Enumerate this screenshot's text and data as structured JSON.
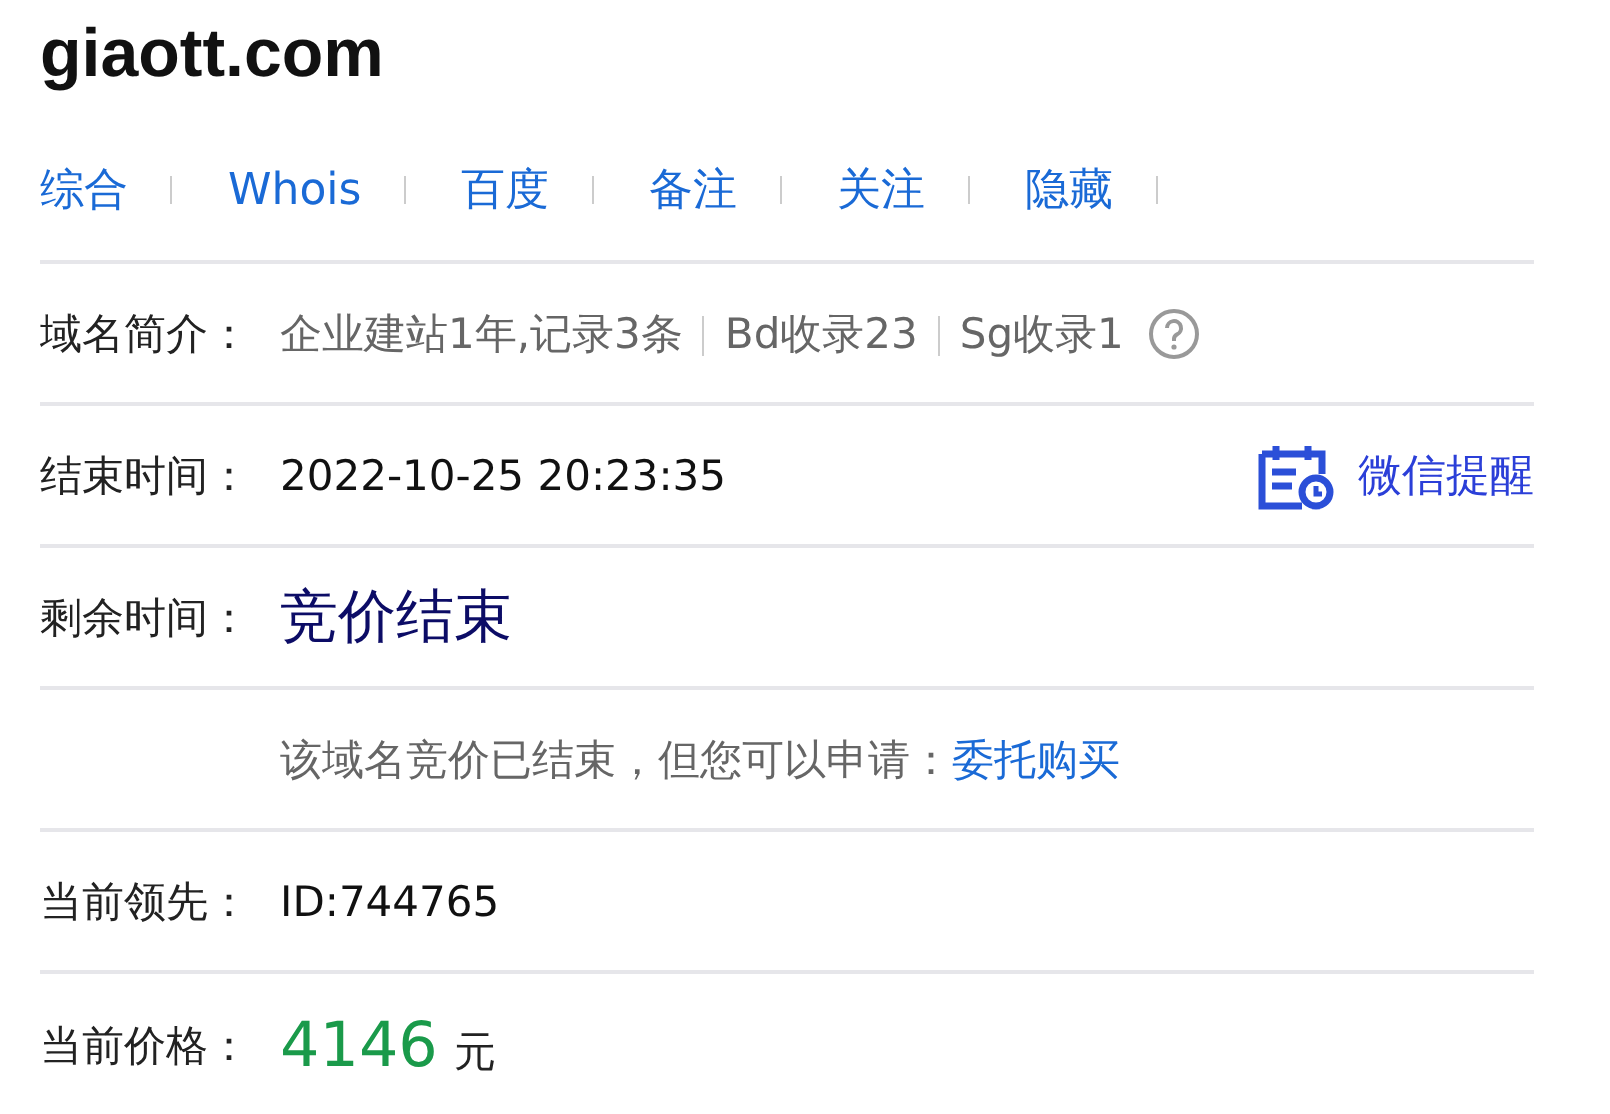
{
  "title": "giaott.com",
  "links": [
    "综合",
    "Whois",
    "百度",
    "备注",
    "关注",
    "隐藏"
  ],
  "rows": [
    {
      "kind": "intro",
      "label": "域名简介：",
      "parts": [
        "企业建站1年,记录3条",
        "Bd收录23",
        "Sg收录1"
      ]
    },
    {
      "kind": "time",
      "label": "结束时间：",
      "value": "2022-10-25 20:23:35",
      "action": "微信提醒"
    },
    {
      "kind": "status",
      "label": "剩余时间：",
      "value": "竞价结束"
    },
    {
      "kind": "note",
      "text": "该域名竞价已结束，但您可以申请：",
      "link": "委托购买"
    },
    {
      "kind": "text",
      "label": "当前领先：",
      "value": "ID:744765"
    },
    {
      "kind": "price",
      "label": "当前价格：",
      "value": "4146",
      "unit": "元"
    }
  ]
}
